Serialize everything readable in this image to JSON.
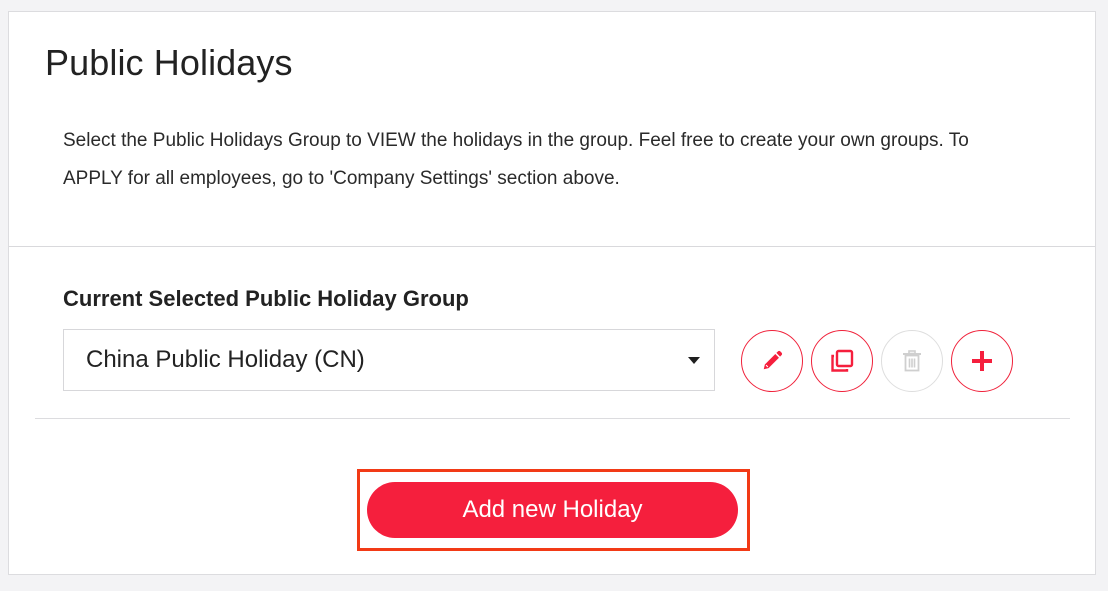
{
  "page": {
    "title": "Public Holidays",
    "description": "Select the Public Holidays Group to VIEW the holidays in the group. Feel free to create your own groups. To APPLY for all employees, go to 'Company Settings' section above."
  },
  "group": {
    "label": "Current Selected Public Holiday Group",
    "selected": "China Public Holiday (CN)"
  },
  "actions": {
    "edit_icon": "pencil-icon",
    "copy_icon": "copy-icon",
    "delete_icon": "trash-icon",
    "delete_disabled": true,
    "add_icon": "plus-icon"
  },
  "add_button": {
    "label": "Add new Holiday"
  },
  "colors": {
    "accent": "#f51f3d",
    "highlight": "#f23a16",
    "disabled": "#cfcfcf"
  }
}
